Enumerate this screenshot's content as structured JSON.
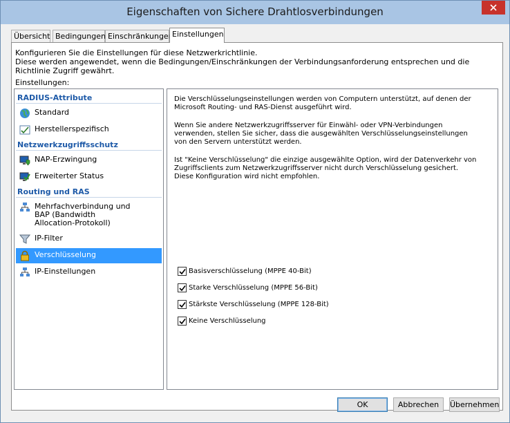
{
  "window": {
    "title": "Eigenschaften von Sichere Drahtlosverbindungen"
  },
  "tabs": [
    {
      "label": "Übersicht"
    },
    {
      "label": "Bedingungen"
    },
    {
      "label": "Einschränkungen"
    },
    {
      "label": "Einstellungen",
      "active": true
    }
  ],
  "description": {
    "line1": "Konfigurieren Sie die Einstellungen für diese Netzwerkrichtlinie.",
    "line2": "Diese werden angewendet, wenn die Bedingungen/Einschränkungen der Verbindungsanforderung entsprechen und die Richtlinie Zugriff gewährt."
  },
  "settings_label": "Einstellungen:",
  "groups": [
    {
      "title": "RADIUS-Attribute",
      "items": [
        {
          "label": "Standard",
          "icon": "globe-icon"
        },
        {
          "label": "Herstellerspezifisch",
          "icon": "checklist-icon"
        }
      ]
    },
    {
      "title": "Netzwerkzugriffsschutz",
      "items": [
        {
          "label": "NAP-Erzwingung",
          "icon": "monitor-shield-icon"
        },
        {
          "label": "Erweiterter Status",
          "icon": "monitor-check-icon"
        }
      ]
    },
    {
      "title": "Routing und RAS",
      "items": [
        {
          "label": "Mehrfachverbindung und BAP (Bandwidth Allocation-Protokoll)",
          "icon": "network-icon"
        },
        {
          "label": "IP-Filter",
          "icon": "funnel-icon"
        },
        {
          "label": "Verschlüsselung",
          "icon": "lock-icon",
          "selected": true
        },
        {
          "label": "IP-Einstellungen",
          "icon": "network-icon"
        }
      ]
    }
  ],
  "details": {
    "para1": "Die Verschlüsselungseinstellungen werden von Computern unterstützt, auf denen der Microsoft Routing- und RAS-Dienst ausgeführt wird.",
    "para2": "Wenn Sie andere Netzwerkzugriffsserver für Einwähl- oder VPN-Verbindungen verwenden, stellen Sie sicher, dass die ausgewählten Verschlüsselungseinstellungen von den Servern unterstützt werden.",
    "para3": "Ist \"Keine Verschlüsselung\" die einzige ausgewählte Option, wird der Datenverkehr von Zugriffsclients zum Netzwerkzugriffsserver nicht durch Verschlüsselung gesichert. Diese Konfiguration wird nicht empfohlen."
  },
  "checkboxes": [
    {
      "label": "Basisverschlüsselung (MPPE 40-Bit)",
      "checked": true
    },
    {
      "label": "Starke Verschlüsselung (MPPE 56-Bit)",
      "checked": true
    },
    {
      "label": "Stärkste Verschlüsselung (MPPE 128-Bit)",
      "checked": true
    },
    {
      "label": "Keine Verschlüsselung",
      "checked": true
    }
  ],
  "buttons": {
    "ok": "OK",
    "cancel": "Abbrechen",
    "apply": "Übernehmen"
  },
  "colors": {
    "titlebar": "#a9c5e4",
    "close": "#c7322b",
    "selection": "#3399ff",
    "group_header": "#1e5aa8"
  }
}
